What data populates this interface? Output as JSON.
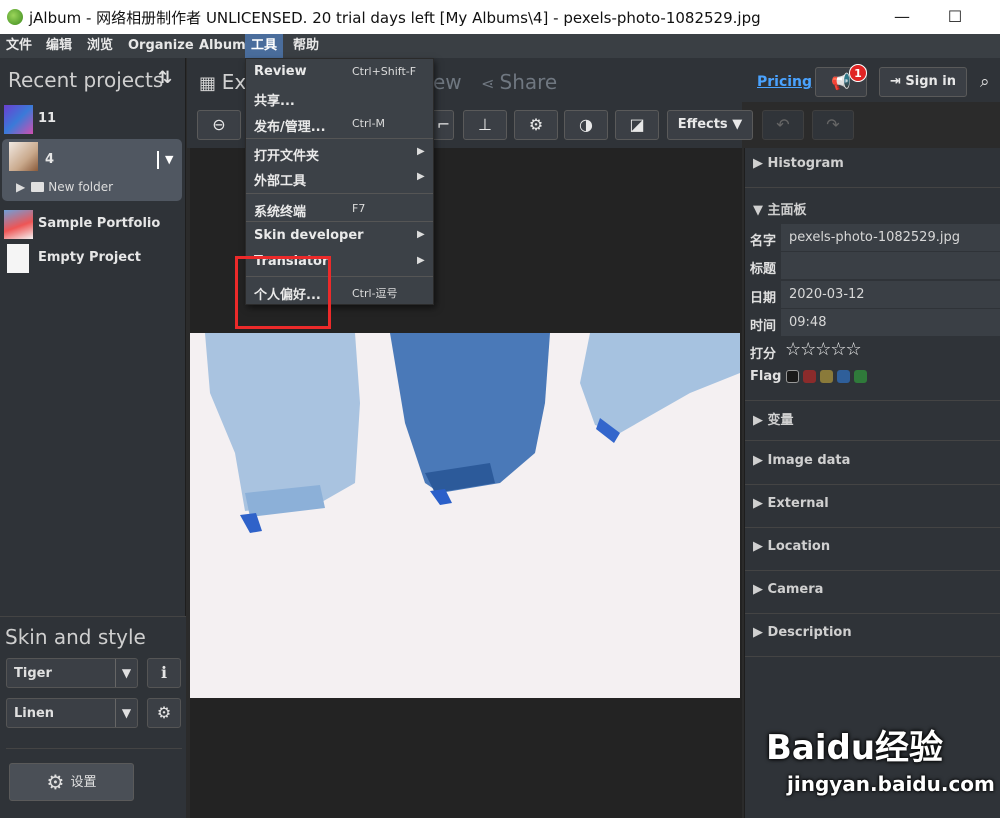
{
  "window": {
    "title": "jAlbum - 网络相册制作者 UNLICENSED. 20 trial days left [My Albums\\4] - pexels-photo-1082529.jpg",
    "minimize": "—",
    "maximize": "☐"
  },
  "menubar": [
    "文件",
    "编辑",
    "浏览",
    "Organize",
    "Album",
    "工具",
    "帮助"
  ],
  "left": {
    "recent_title": "Recent projects",
    "sort_icon": "⇅",
    "projects": [
      {
        "label": "11"
      },
      {
        "label": "4",
        "sub": "New folder"
      },
      {
        "label": "Sample Portfolio"
      },
      {
        "label": "Empty Project"
      }
    ],
    "skin_title": "Skin and style",
    "skin": "Tiger",
    "style": "Linen",
    "skin_info_icon": "ℹ",
    "style_gear_icon": "⚙",
    "dropdown_arrow": "▼",
    "settings_label": "设置"
  },
  "top": {
    "tab_partial_1": "Ex",
    "tab_partial_2": "ew",
    "tab_share": "Share",
    "pricing": "Pricing",
    "notif_count": "1",
    "signin": "Sign in"
  },
  "tools": {
    "effects": "Effects ▼"
  },
  "dropdown": {
    "items": [
      {
        "label": "Review",
        "shortcut": "Ctrl+Shift-F"
      },
      {
        "label": "共享..."
      },
      {
        "label": "发布/管理...",
        "shortcut": "Ctrl-M"
      },
      {
        "label": "打开文件夹",
        "submenu": "▶"
      },
      {
        "label": "外部工具",
        "submenu": "▶"
      },
      {
        "label": "系统终端",
        "shortcut": "F7"
      },
      {
        "label": "Skin developer",
        "submenu": "▶"
      },
      {
        "label": "Translator",
        "submenu": "▶"
      },
      {
        "label": "个人偏好...",
        "shortcut": "Ctrl-逗号"
      }
    ]
  },
  "right": {
    "histogram": "Histogram",
    "main_panel": "主面板",
    "name_label": "名字",
    "name_value": "pexels-photo-1082529.jpg",
    "title_label": "标题",
    "title_value": "",
    "date_label": "日期",
    "date_value": "2020-03-12",
    "time_label": "时间",
    "time_value": "09:48",
    "rating_label": "打分",
    "rating_stars": 0,
    "flag_label": "Flag",
    "flag_colors": [
      "#1a1a1a",
      "#8b2b2b",
      "#8a7a3a",
      "#2f5f9a",
      "#2f7a3a"
    ],
    "sections": [
      "变量",
      "Image data",
      "External",
      "Location",
      "Camera",
      "Description"
    ],
    "collapsed_arrow": "▶",
    "expanded_arrow": "▼"
  },
  "watermark": {
    "logo": "Baidu经验",
    "url": "jingyan.baidu.com"
  }
}
